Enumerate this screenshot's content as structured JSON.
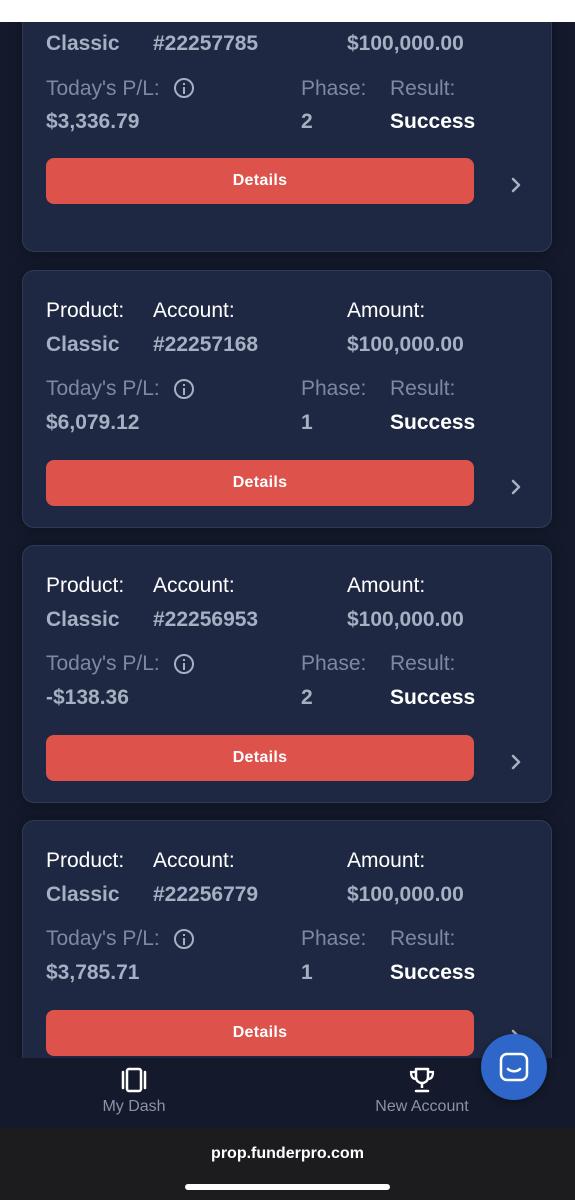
{
  "labels": {
    "product": "Product:",
    "account": "Account:",
    "amount": "Amount:",
    "todays_pl": "Today's P/L:",
    "phase": "Phase:",
    "result": "Result:",
    "details": "Details"
  },
  "accounts": [
    {
      "product": "Classic",
      "account": "#22257785",
      "amount": "$100,000.00",
      "pl": "$3,336.79",
      "phase": "2",
      "result": "Success"
    },
    {
      "product": "Classic",
      "account": "#22257168",
      "amount": "$100,000.00",
      "pl": "$6,079.12",
      "phase": "1",
      "result": "Success"
    },
    {
      "product": "Classic",
      "account": "#22256953",
      "amount": "$100,000.00",
      "pl": "-$138.36",
      "phase": "2",
      "result": "Success"
    },
    {
      "product": "Classic",
      "account": "#22256779",
      "amount": "$100,000.00",
      "pl": "$3,785.71",
      "phase": "1",
      "result": "Success"
    }
  ],
  "nav": {
    "my_dash": "My Dash",
    "new_account": "New Account"
  },
  "browser": {
    "url": "prop.funderpro.com"
  },
  "colors": {
    "background": "#141a2c",
    "card": "#1f2842",
    "button": "#de524c",
    "chat": "#2f66c9"
  },
  "icons": [
    "info-icon",
    "chevron-right-icon",
    "dashboard-icon",
    "trophy-icon",
    "chat-icon"
  ]
}
